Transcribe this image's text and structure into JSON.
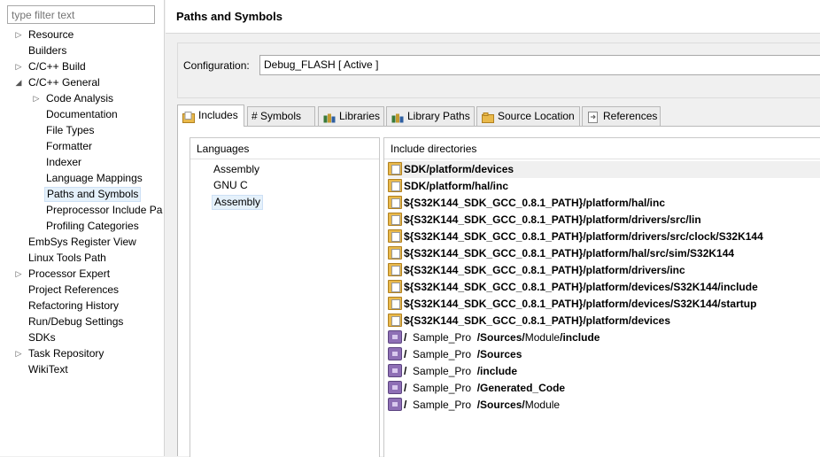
{
  "filter": {
    "placeholder": "type filter text"
  },
  "nav": {
    "items": [
      {
        "label": "Resource",
        "arrow": "▷",
        "level": 0
      },
      {
        "label": "Builders",
        "arrow": "",
        "level": 0
      },
      {
        "label": "C/C++ Build",
        "arrow": "▷",
        "level": 0
      },
      {
        "label": "C/C++ General",
        "arrow": "◢",
        "level": 0
      },
      {
        "label": "Code Analysis",
        "arrow": "▷",
        "level": 1
      },
      {
        "label": "Documentation",
        "arrow": "",
        "level": 1
      },
      {
        "label": "File Types",
        "arrow": "",
        "level": 1
      },
      {
        "label": "Formatter",
        "arrow": "",
        "level": 1
      },
      {
        "label": "Indexer",
        "arrow": "",
        "level": 1
      },
      {
        "label": "Language Mappings",
        "arrow": "",
        "level": 1
      },
      {
        "label": "Paths and Symbols",
        "arrow": "",
        "level": 1,
        "selected": true
      },
      {
        "label": "Preprocessor Include Pa",
        "arrow": "",
        "level": 1
      },
      {
        "label": "Profiling Categories",
        "arrow": "",
        "level": 1
      },
      {
        "label": "EmbSys Register View",
        "arrow": "",
        "level": 0
      },
      {
        "label": "Linux Tools Path",
        "arrow": "",
        "level": 0
      },
      {
        "label": "Processor Expert",
        "arrow": "▷",
        "level": 0
      },
      {
        "label": "Project References",
        "arrow": "",
        "level": 0
      },
      {
        "label": "Refactoring History",
        "arrow": "",
        "level": 0
      },
      {
        "label": "Run/Debug Settings",
        "arrow": "",
        "level": 0
      },
      {
        "label": "SDKs",
        "arrow": "",
        "level": 0
      },
      {
        "label": "Task Repository",
        "arrow": "▷",
        "level": 0
      },
      {
        "label": "WikiText",
        "arrow": "",
        "level": 0
      }
    ]
  },
  "page": {
    "title": "Paths and Symbols"
  },
  "config": {
    "label": "Configuration:",
    "value": "Debug_FLASH  [ Active ]"
  },
  "tabs": [
    {
      "label": "Includes",
      "icon": "includes-icon"
    },
    {
      "label": "# Symbols",
      "icon": "symbols-icon"
    },
    {
      "label": "Libraries",
      "icon": "libraries-icon"
    },
    {
      "label": "Library Paths",
      "icon": "library-paths-icon"
    },
    {
      "label": "Source Location",
      "icon": "source-location-icon"
    },
    {
      "label": "References",
      "icon": "references-icon"
    }
  ],
  "languages": {
    "header": "Languages",
    "items": [
      "Assembly",
      "GNU C",
      "Assembly"
    ]
  },
  "includes": {
    "header": "Include directories",
    "rows": [
      {
        "icon": "folder",
        "parts": [
          {
            "t": "SDK/platform/devices",
            "b": true
          }
        ]
      },
      {
        "icon": "folder",
        "parts": [
          {
            "t": "SDK/platform/hal/inc",
            "b": true
          }
        ]
      },
      {
        "icon": "folder",
        "parts": [
          {
            "t": "${S32K144_SDK_GCC_0.8.1_PATH}/platform/hal/inc",
            "b": true
          }
        ]
      },
      {
        "icon": "folder",
        "parts": [
          {
            "t": "${S32K144_SDK_GCC_0.8.1_PATH}/platform/drivers/src/lin",
            "b": true
          }
        ]
      },
      {
        "icon": "folder",
        "parts": [
          {
            "t": "${S32K144_SDK_GCC_0.8.1_PATH}/platform/drivers/src/clock/S32K144",
            "b": true
          }
        ]
      },
      {
        "icon": "folder",
        "parts": [
          {
            "t": "${S32K144_SDK_GCC_0.8.1_PATH}/platform/hal/src/sim/S32K144",
            "b": true
          }
        ]
      },
      {
        "icon": "folder",
        "parts": [
          {
            "t": "${S32K144_SDK_GCC_0.8.1_PATH}/platform/drivers/inc",
            "b": true
          }
        ]
      },
      {
        "icon": "folder",
        "parts": [
          {
            "t": "${S32K144_SDK_GCC_0.8.1_PATH}/platform/devices/S32K144/include",
            "b": true
          }
        ]
      },
      {
        "icon": "folder",
        "parts": [
          {
            "t": "${S32K144_SDK_GCC_0.8.1_PATH}/platform/devices/S32K144/startup",
            "b": true
          }
        ]
      },
      {
        "icon": "folder",
        "parts": [
          {
            "t": "${S32K144_SDK_GCC_0.8.1_PATH}/platform/devices",
            "b": true
          }
        ]
      },
      {
        "icon": "project",
        "parts": [
          {
            "t": "/",
            "b": true
          },
          {
            "t": "  Sample_Pro  ",
            "b": false
          },
          {
            "t": "/Sources/",
            "b": true
          },
          {
            "t": "Module",
            "b": false
          },
          {
            "t": "/include",
            "b": true
          }
        ]
      },
      {
        "icon": "project",
        "parts": [
          {
            "t": "/",
            "b": true
          },
          {
            "t": "  Sample_Pro  ",
            "b": false
          },
          {
            "t": "/Sources",
            "b": true
          }
        ]
      },
      {
        "icon": "project",
        "parts": [
          {
            "t": "/",
            "b": true
          },
          {
            "t": "  Sample_Pro  ",
            "b": false
          },
          {
            "t": "/include",
            "b": true
          }
        ]
      },
      {
        "icon": "project",
        "parts": [
          {
            "t": "/",
            "b": true
          },
          {
            "t": "  Sample_Pro  ",
            "b": false
          },
          {
            "t": "/Generated_Code",
            "b": true
          }
        ]
      },
      {
        "icon": "project",
        "parts": [
          {
            "t": "/",
            "b": true
          },
          {
            "t": "  Sample_Pro  ",
            "b": false
          },
          {
            "t": "/Sources/",
            "b": true
          },
          {
            "t": "Module",
            "b": false
          }
        ]
      }
    ]
  }
}
